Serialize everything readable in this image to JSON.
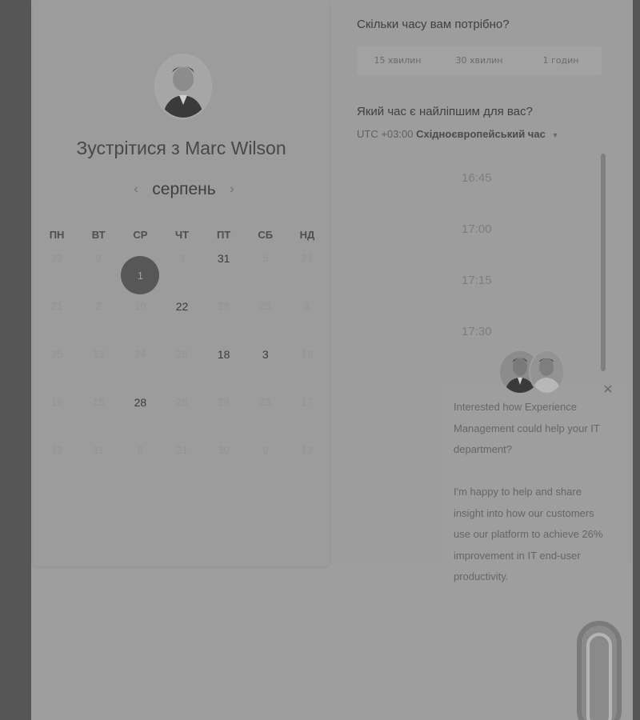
{
  "colors": {
    "overlay_dark": "#565656",
    "panel": "#9e9e9e",
    "selected_day": "#575757"
  },
  "host": {
    "title_prefix": "Зустрітися з",
    "name": "Marc Wilson"
  },
  "calendar": {
    "month": "серпень",
    "prev_icon": "chevron-left-icon",
    "next_icon": "chevron-right-icon",
    "weekdays": [
      "ПН",
      "ВТ",
      "СР",
      "ЧТ",
      "ПТ",
      "СБ",
      "НД"
    ],
    "selected_day": "1",
    "rows": [
      [
        "22",
        "9",
        "1",
        "3",
        "31",
        "5",
        "21"
      ],
      [
        "21",
        "2",
        "10",
        "22",
        "28",
        "25",
        "3"
      ],
      [
        "25",
        "13",
        "24",
        "26",
        "18",
        "3",
        "19"
      ],
      [
        "16",
        "15",
        "28",
        "20",
        "29",
        "23",
        "17"
      ],
      [
        "12",
        "11",
        "8",
        "21",
        "30",
        "9",
        "12"
      ]
    ],
    "available": [
      [
        0,
        4
      ],
      [
        1,
        3
      ],
      [
        2,
        4
      ],
      [
        2,
        5
      ],
      [
        3,
        2
      ]
    ]
  },
  "duration": {
    "question": "Скільки часу вам потрібно?",
    "options": [
      "15 хвилин",
      "30 хвилин",
      "1 годин"
    ]
  },
  "time": {
    "question": "Який час є найліпшим для вас?",
    "timezone_offset": "UTC +03:00",
    "timezone_name": "Східноєвропейський час",
    "slots": [
      "16:45",
      "17:00",
      "17:15",
      "17:30"
    ]
  },
  "chat": {
    "message_1": "Interested how Experience Management could help your IT department?",
    "message_2": "I'm happy to help and share insight into how our customers use our platform to achieve 26% improvement in IT end-user productivity."
  }
}
